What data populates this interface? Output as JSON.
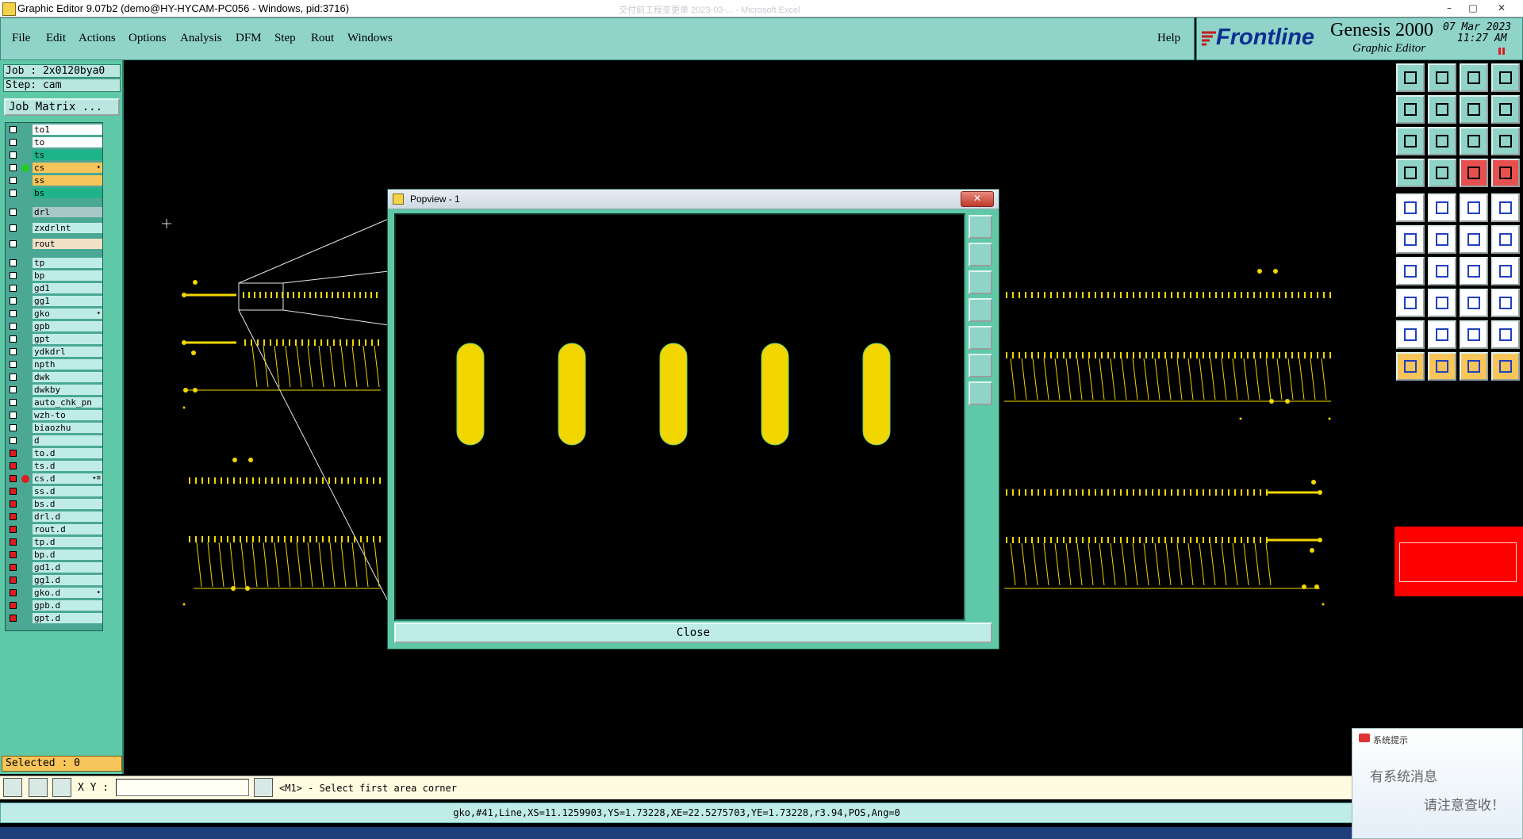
{
  "window": {
    "title": "Graphic Editor 9.07b2 (demo@HY-HYCAM-PC056 - Windows, pid:3716)",
    "background_hint": "交付前工程变更单 2023-03-... - Microsoft Excel",
    "minimize": "–",
    "maximize": "□",
    "close": "✕"
  },
  "menu": {
    "items": [
      "File",
      "Edit",
      "Actions",
      "Options",
      "Analysis",
      "DFM",
      "Step",
      "Rout",
      "Windows"
    ],
    "help": "Help"
  },
  "brand": {
    "logo": "Frontline",
    "product": "Genesis 2000",
    "subtitle": "Graphic Editor",
    "date": "07 Mar 2023",
    "time": "11:27 AM"
  },
  "job": {
    "job_label": "Job : 2x0120bya0",
    "step_label": "Step: cam",
    "matrix_button": "Job Matrix ..."
  },
  "layers": [
    {
      "name": "to1",
      "bg": "#ffffff",
      "checkbox": "white"
    },
    {
      "name": "to",
      "bg": "#ffffff",
      "checkbox": "white"
    },
    {
      "name": "ts",
      "bg": "#1fb38a",
      "checkbox": "white"
    },
    {
      "name": "cs",
      "bg": "#f7c55a",
      "checkbox": "white",
      "dot": "#22cc22",
      "mark": "✦"
    },
    {
      "name": "ss",
      "bg": "#f7c55a",
      "checkbox": "white"
    },
    {
      "name": "bs",
      "bg": "#1fb38a",
      "checkbox": "white"
    },
    {
      "name": "drl",
      "bg": "#a8c8c8",
      "checkbox": "white"
    },
    {
      "name": "zxdrlnt",
      "bg": "#bfece6",
      "checkbox": "white"
    },
    {
      "name": "rout",
      "bg": "#f0e0c8",
      "checkbox": "white"
    },
    {
      "name": "tp",
      "bg": "#bfece6",
      "checkbox": "white"
    },
    {
      "name": "bp",
      "bg": "#bfece6",
      "checkbox": "white"
    },
    {
      "name": "gd1",
      "bg": "#bfece6",
      "checkbox": "white"
    },
    {
      "name": "gg1",
      "bg": "#bfece6",
      "checkbox": "white"
    },
    {
      "name": "gko",
      "bg": "#bfece6",
      "checkbox": "white",
      "mark": "✦"
    },
    {
      "name": "gpb",
      "bg": "#bfece6",
      "checkbox": "white"
    },
    {
      "name": "gpt",
      "bg": "#bfece6",
      "checkbox": "white"
    },
    {
      "name": "ydkdrl",
      "bg": "#bfece6",
      "checkbox": "white"
    },
    {
      "name": "npth",
      "bg": "#bfece6",
      "checkbox": "white"
    },
    {
      "name": "dwk",
      "bg": "#bfece6",
      "checkbox": "white"
    },
    {
      "name": "dwkby",
      "bg": "#bfece6",
      "checkbox": "white"
    },
    {
      "name": "auto_chk_pn",
      "bg": "#bfece6",
      "checkbox": "white"
    },
    {
      "name": "wzh-to",
      "bg": "#bfece6",
      "checkbox": "white"
    },
    {
      "name": "biaozhu",
      "bg": "#bfece6",
      "checkbox": "white"
    },
    {
      "name": "d",
      "bg": "#bfece6",
      "checkbox": "white"
    },
    {
      "name": "to.d",
      "bg": "#bfece6",
      "checkbox": "red"
    },
    {
      "name": "ts.d",
      "bg": "#bfece6",
      "checkbox": "red"
    },
    {
      "name": "cs.d",
      "bg": "#bfece6",
      "checkbox": "red",
      "dot": "#e01c1c",
      "mark": "✦≡"
    },
    {
      "name": "ss.d",
      "bg": "#bfece6",
      "checkbox": "red"
    },
    {
      "name": "bs.d",
      "bg": "#bfece6",
      "checkbox": "red"
    },
    {
      "name": "drl.d",
      "bg": "#bfece6",
      "checkbox": "red"
    },
    {
      "name": "rout.d",
      "bg": "#bfece6",
      "checkbox": "red"
    },
    {
      "name": "tp.d",
      "bg": "#bfece6",
      "checkbox": "red"
    },
    {
      "name": "bp.d",
      "bg": "#bfece6",
      "checkbox": "red"
    },
    {
      "name": "gd1.d",
      "bg": "#bfece6",
      "checkbox": "red"
    },
    {
      "name": "gg1.d",
      "bg": "#bfece6",
      "checkbox": "red"
    },
    {
      "name": "gko.d",
      "bg": "#bfece6",
      "checkbox": "red",
      "mark": "✦"
    },
    {
      "name": "gpb.d",
      "bg": "#bfece6",
      "checkbox": "red"
    },
    {
      "name": "gpt.d",
      "bg": "#bfece6",
      "checkbox": "red"
    }
  ],
  "selected": "Selected : 0",
  "popview": {
    "title": "Popview - 1",
    "close_x": "✕",
    "close_button": "Close"
  },
  "command": {
    "xy_label": "X Y :",
    "xy_value": "",
    "prompt": "<M1> - Select first area corner"
  },
  "status": "gko,#41,Line,XS=11.1259903,YS=1.73228,XE=22.5275703,YE=1.73228,r3.94,POS,Ang=0",
  "notification": {
    "title": "系统提示",
    "line1": "有系统消息",
    "line2": "请注意查收！"
  },
  "colors": {
    "pad": "#f2d600",
    "panel": "#5fc9a7",
    "menu": "#8fd3c9",
    "highlight": "#ff0000"
  }
}
